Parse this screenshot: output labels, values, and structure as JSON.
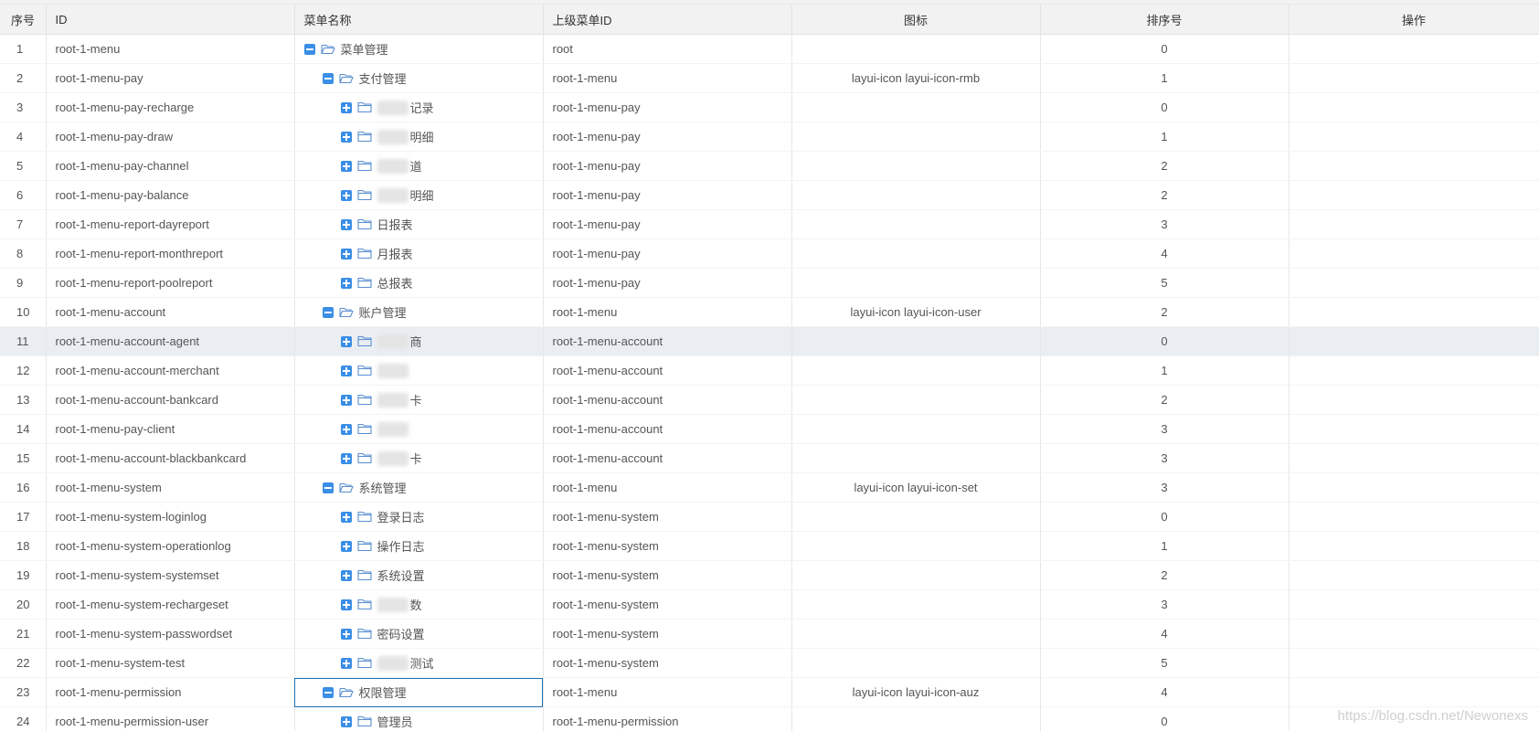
{
  "table": {
    "headers": {
      "seq": "序号",
      "id": "ID",
      "name": "菜单名称",
      "parent": "上级菜单ID",
      "icon": "图标",
      "sort": "排序号",
      "op": "操作"
    },
    "rows": [
      {
        "seq": "1",
        "id": "root-1-menu",
        "name": "菜单管理",
        "parent": "root",
        "icon": "",
        "sort": "0",
        "level": 0,
        "expanded": true
      },
      {
        "seq": "2",
        "id": "root-1-menu-pay",
        "name": "支付管理",
        "parent": "root-1-menu",
        "icon": "layui-icon layui-icon-rmb",
        "sort": "1",
        "level": 1,
        "expanded": true
      },
      {
        "seq": "3",
        "id": "root-1-menu-pay-recharge",
        "name": "记录",
        "parent": "root-1-menu-pay",
        "icon": "",
        "sort": "0",
        "level": 2,
        "expanded": false,
        "masked": true
      },
      {
        "seq": "4",
        "id": "root-1-menu-pay-draw",
        "name": "明细",
        "parent": "root-1-menu-pay",
        "icon": "",
        "sort": "1",
        "level": 2,
        "expanded": false,
        "masked": true
      },
      {
        "seq": "5",
        "id": "root-1-menu-pay-channel",
        "name": "道",
        "parent": "root-1-menu-pay",
        "icon": "",
        "sort": "2",
        "level": 2,
        "expanded": false,
        "masked": true
      },
      {
        "seq": "6",
        "id": "root-1-menu-pay-balance",
        "name": "明细",
        "parent": "root-1-menu-pay",
        "icon": "",
        "sort": "2",
        "level": 2,
        "expanded": false,
        "masked": true
      },
      {
        "seq": "7",
        "id": "root-1-menu-report-dayreport",
        "name": "日报表",
        "parent": "root-1-menu-pay",
        "icon": "",
        "sort": "3",
        "level": 2,
        "expanded": false
      },
      {
        "seq": "8",
        "id": "root-1-menu-report-monthreport",
        "name": "月报表",
        "parent": "root-1-menu-pay",
        "icon": "",
        "sort": "4",
        "level": 2,
        "expanded": false
      },
      {
        "seq": "9",
        "id": "root-1-menu-report-poolreport",
        "name": "总报表",
        "parent": "root-1-menu-pay",
        "icon": "",
        "sort": "5",
        "level": 2,
        "expanded": false
      },
      {
        "seq": "10",
        "id": "root-1-menu-account",
        "name": "账户管理",
        "parent": "root-1-menu",
        "icon": "layui-icon layui-icon-user",
        "sort": "2",
        "level": 1,
        "expanded": true
      },
      {
        "seq": "11",
        "id": "root-1-menu-account-agent",
        "name": "商",
        "parent": "root-1-menu-account",
        "icon": "",
        "sort": "0",
        "level": 2,
        "expanded": false,
        "masked": true,
        "hover": true
      },
      {
        "seq": "12",
        "id": "root-1-menu-account-merchant",
        "name": "",
        "parent": "root-1-menu-account",
        "icon": "",
        "sort": "1",
        "level": 2,
        "expanded": false,
        "masked": true
      },
      {
        "seq": "13",
        "id": "root-1-menu-account-bankcard",
        "name": "卡",
        "parent": "root-1-menu-account",
        "icon": "",
        "sort": "2",
        "level": 2,
        "expanded": false,
        "masked": true
      },
      {
        "seq": "14",
        "id": "root-1-menu-pay-client",
        "name": "",
        "parent": "root-1-menu-account",
        "icon": "",
        "sort": "3",
        "level": 2,
        "expanded": false,
        "masked": true
      },
      {
        "seq": "15",
        "id": "root-1-menu-account-blackbankcard",
        "name": "卡",
        "parent": "root-1-menu-account",
        "icon": "",
        "sort": "3",
        "level": 2,
        "expanded": false,
        "masked": true
      },
      {
        "seq": "16",
        "id": "root-1-menu-system",
        "name": "系统管理",
        "parent": "root-1-menu",
        "icon": "layui-icon layui-icon-set",
        "sort": "3",
        "level": 1,
        "expanded": true
      },
      {
        "seq": "17",
        "id": "root-1-menu-system-loginlog",
        "name": "登录日志",
        "parent": "root-1-menu-system",
        "icon": "",
        "sort": "0",
        "level": 2,
        "expanded": false
      },
      {
        "seq": "18",
        "id": "root-1-menu-system-operationlog",
        "name": "操作日志",
        "parent": "root-1-menu-system",
        "icon": "",
        "sort": "1",
        "level": 2,
        "expanded": false
      },
      {
        "seq": "19",
        "id": "root-1-menu-system-systemset",
        "name": "系统设置",
        "parent": "root-1-menu-system",
        "icon": "",
        "sort": "2",
        "level": 2,
        "expanded": false
      },
      {
        "seq": "20",
        "id": "root-1-menu-system-rechargeset",
        "name": "数",
        "parent": "root-1-menu-system",
        "icon": "",
        "sort": "3",
        "level": 2,
        "expanded": false,
        "masked": true
      },
      {
        "seq": "21",
        "id": "root-1-menu-system-passwordset",
        "name": "密码设置",
        "parent": "root-1-menu-system",
        "icon": "",
        "sort": "4",
        "level": 2,
        "expanded": false
      },
      {
        "seq": "22",
        "id": "root-1-menu-system-test",
        "name": "测试",
        "parent": "root-1-menu-system",
        "icon": "",
        "sort": "5",
        "level": 2,
        "expanded": false,
        "masked": true
      },
      {
        "seq": "23",
        "id": "root-1-menu-permission",
        "name": "权限管理",
        "parent": "root-1-menu",
        "icon": "layui-icon layui-icon-auz",
        "sort": "4",
        "level": 1,
        "expanded": true,
        "selected": true
      },
      {
        "seq": "24",
        "id": "root-1-menu-permission-user",
        "name": "管理员",
        "parent": "root-1-menu-permission",
        "icon": "",
        "sort": "0",
        "level": 2,
        "expanded": false
      }
    ]
  },
  "watermark": "https://blog.csdn.net/Newonexs",
  "colors": {
    "accent": "#3a8ee6",
    "hover_row": "#eaeef3",
    "selected_border": "#1e6fb5",
    "header_bg": "#f2f2f2"
  },
  "icons": {
    "expand": "minus-square-icon",
    "collapse": "plus-square-icon",
    "open_folder": "folder-open-icon",
    "closed_folder": "folder-icon"
  }
}
